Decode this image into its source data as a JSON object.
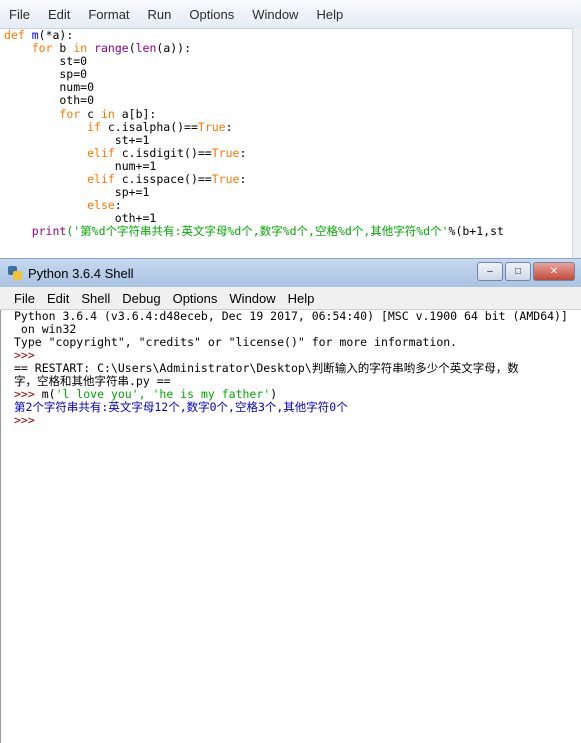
{
  "editor": {
    "menu": [
      "File",
      "Edit",
      "Format",
      "Run",
      "Options",
      "Window",
      "Help"
    ],
    "code": [
      {
        "parts": [
          {
            "t": "def ",
            "c": "kw"
          },
          {
            "t": "m",
            "c": "fn"
          },
          {
            "t": "(*a):",
            "c": ""
          }
        ]
      },
      {
        "parts": [
          {
            "t": "    ",
            "c": ""
          },
          {
            "t": "for",
            "c": "kw"
          },
          {
            "t": " b ",
            "c": ""
          },
          {
            "t": "in",
            "c": "kw"
          },
          {
            "t": " ",
            "c": ""
          },
          {
            "t": "range",
            "c": "bi"
          },
          {
            "t": "(",
            "c": ""
          },
          {
            "t": "len",
            "c": "bi"
          },
          {
            "t": "(a)):",
            "c": ""
          }
        ]
      },
      {
        "parts": [
          {
            "t": "        st=0",
            "c": ""
          }
        ]
      },
      {
        "parts": [
          {
            "t": "        sp=0",
            "c": ""
          }
        ]
      },
      {
        "parts": [
          {
            "t": "        num=0",
            "c": ""
          }
        ]
      },
      {
        "parts": [
          {
            "t": "        oth=0",
            "c": ""
          }
        ]
      },
      {
        "parts": [
          {
            "t": "        ",
            "c": ""
          },
          {
            "t": "for",
            "c": "kw"
          },
          {
            "t": " c ",
            "c": ""
          },
          {
            "t": "in",
            "c": "kw"
          },
          {
            "t": " a[b]:",
            "c": ""
          }
        ]
      },
      {
        "parts": [
          {
            "t": "            ",
            "c": ""
          },
          {
            "t": "if",
            "c": "kw"
          },
          {
            "t": " c.isalpha()==",
            "c": ""
          },
          {
            "t": "True",
            "c": "kw"
          },
          {
            "t": ":",
            "c": ""
          }
        ]
      },
      {
        "parts": [
          {
            "t": "                st+=1",
            "c": ""
          }
        ]
      },
      {
        "parts": [
          {
            "t": "            ",
            "c": ""
          },
          {
            "t": "elif",
            "c": "kw"
          },
          {
            "t": " c.isdigit()==",
            "c": ""
          },
          {
            "t": "True",
            "c": "kw"
          },
          {
            "t": ":",
            "c": ""
          }
        ]
      },
      {
        "parts": [
          {
            "t": "                num+=1",
            "c": ""
          }
        ]
      },
      {
        "parts": [
          {
            "t": "            ",
            "c": ""
          },
          {
            "t": "elif",
            "c": "kw"
          },
          {
            "t": " c.isspace()==",
            "c": ""
          },
          {
            "t": "True",
            "c": "kw"
          },
          {
            "t": ":",
            "c": ""
          }
        ]
      },
      {
        "parts": [
          {
            "t": "                sp+=1",
            "c": ""
          }
        ]
      },
      {
        "parts": [
          {
            "t": "            ",
            "c": ""
          },
          {
            "t": "else",
            "c": "kw"
          },
          {
            "t": ":",
            "c": ""
          }
        ]
      },
      {
        "parts": [
          {
            "t": "                oth+=1",
            "c": ""
          }
        ]
      },
      {
        "parts": [
          {
            "t": "    ",
            "c": ""
          },
          {
            "t": "print",
            "c": "bi"
          },
          {
            "t": "('第%d个字符串共有:英文字母%d个,数字%d个,空格%d个,其他字符%d个'",
            "c": "str"
          },
          {
            "t": "%(b+1,st",
            "c": ""
          }
        ]
      }
    ]
  },
  "shell": {
    "title": "Python 3.6.4 Shell",
    "window_buttons": [
      "–",
      "□",
      "✕"
    ],
    "menu": [
      "File",
      "Edit",
      "Shell",
      "Debug",
      "Options",
      "Window",
      "Help"
    ],
    "output": [
      {
        "parts": [
          {
            "t": "Python 3.6.4 (v3.6.4:d48eceb, Dec 19 2017, 06:54:40) [MSC v.1900 64 bit (AMD64)]",
            "c": ""
          }
        ]
      },
      {
        "parts": [
          {
            "t": " on win32",
            "c": ""
          }
        ]
      },
      {
        "parts": [
          {
            "t": "Type \"copyright\", \"credits\" or \"license()\" for more information.",
            "c": ""
          }
        ]
      },
      {
        "parts": [
          {
            "t": ">>> ",
            "c": "prompt"
          }
        ]
      },
      {
        "parts": [
          {
            "t": "== RESTART: C:\\Users\\Administrator\\Desktop\\判断输入的字符串哟多少个英文字母，数",
            "c": ""
          }
        ]
      },
      {
        "parts": [
          {
            "t": "字，空格和其他字符串.py ==",
            "c": ""
          }
        ]
      },
      {
        "parts": [
          {
            "t": ">>> ",
            "c": "prompt"
          },
          {
            "t": "m(",
            "c": "uin"
          },
          {
            "t": "'l love you', 'he is my father'",
            "c": "ustr"
          },
          {
            "t": ")",
            "c": "uin"
          }
        ]
      },
      {
        "parts": [
          {
            "t": "第2个字符串共有:英文字母12个,数字0个,空格3个,其他字符0个",
            "c": "blue"
          }
        ]
      },
      {
        "parts": [
          {
            "t": ">>> ",
            "c": "prompt"
          }
        ]
      }
    ]
  },
  "colors": {
    "keyword": "#ff7700",
    "string": "#00aa00",
    "builtin": "#900090",
    "output": "#0000c8",
    "prompt": "#990000"
  }
}
